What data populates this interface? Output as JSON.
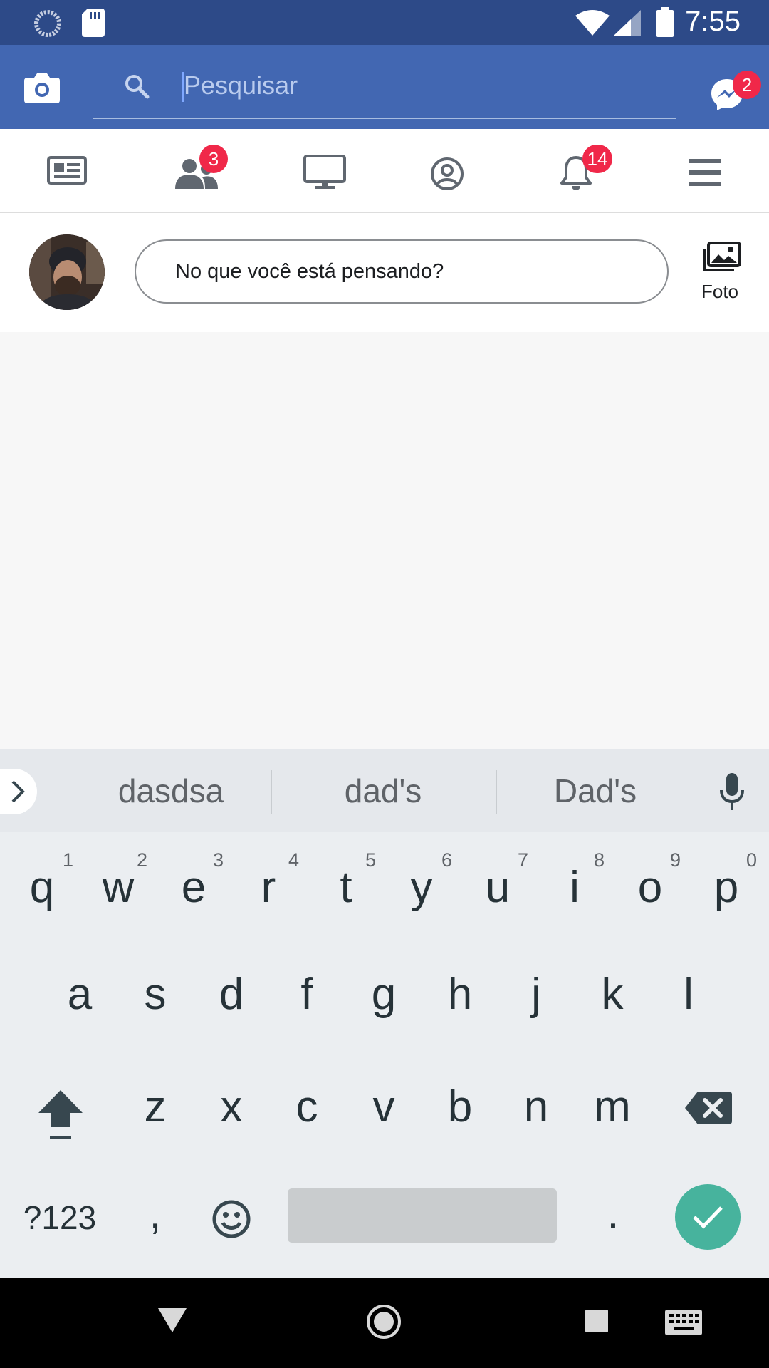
{
  "status_bar": {
    "time": "7:55"
  },
  "header": {
    "search_placeholder": "Pesquisar",
    "messenger_badge": "2"
  },
  "tabs": [
    {
      "name": "news-feed",
      "badge": ""
    },
    {
      "name": "friends",
      "badge": "3"
    },
    {
      "name": "watch",
      "badge": ""
    },
    {
      "name": "profile",
      "badge": ""
    },
    {
      "name": "notifications",
      "badge": "14"
    },
    {
      "name": "menu",
      "badge": ""
    }
  ],
  "composer": {
    "prompt": "No que você está pensando?",
    "photo_label": "Foto"
  },
  "keyboard": {
    "suggestions": [
      "dasdsa",
      "dad's",
      "Dad's"
    ],
    "row1": [
      "q",
      "w",
      "e",
      "r",
      "t",
      "y",
      "u",
      "i",
      "o",
      "p"
    ],
    "row1_hints": [
      "1",
      "2",
      "3",
      "4",
      "5",
      "6",
      "7",
      "8",
      "9",
      "0"
    ],
    "row2": [
      "a",
      "s",
      "d",
      "f",
      "g",
      "h",
      "j",
      "k",
      "l"
    ],
    "row3": [
      "z",
      "x",
      "c",
      "v",
      "b",
      "n",
      "m"
    ],
    "symbols_label": "?123",
    "comma": ",",
    "period": "."
  },
  "colors": {
    "brand_blue": "#4267b2",
    "status_bar": "#2d4a88",
    "badge_red": "#f02849",
    "enter_teal": "#47b39d"
  }
}
